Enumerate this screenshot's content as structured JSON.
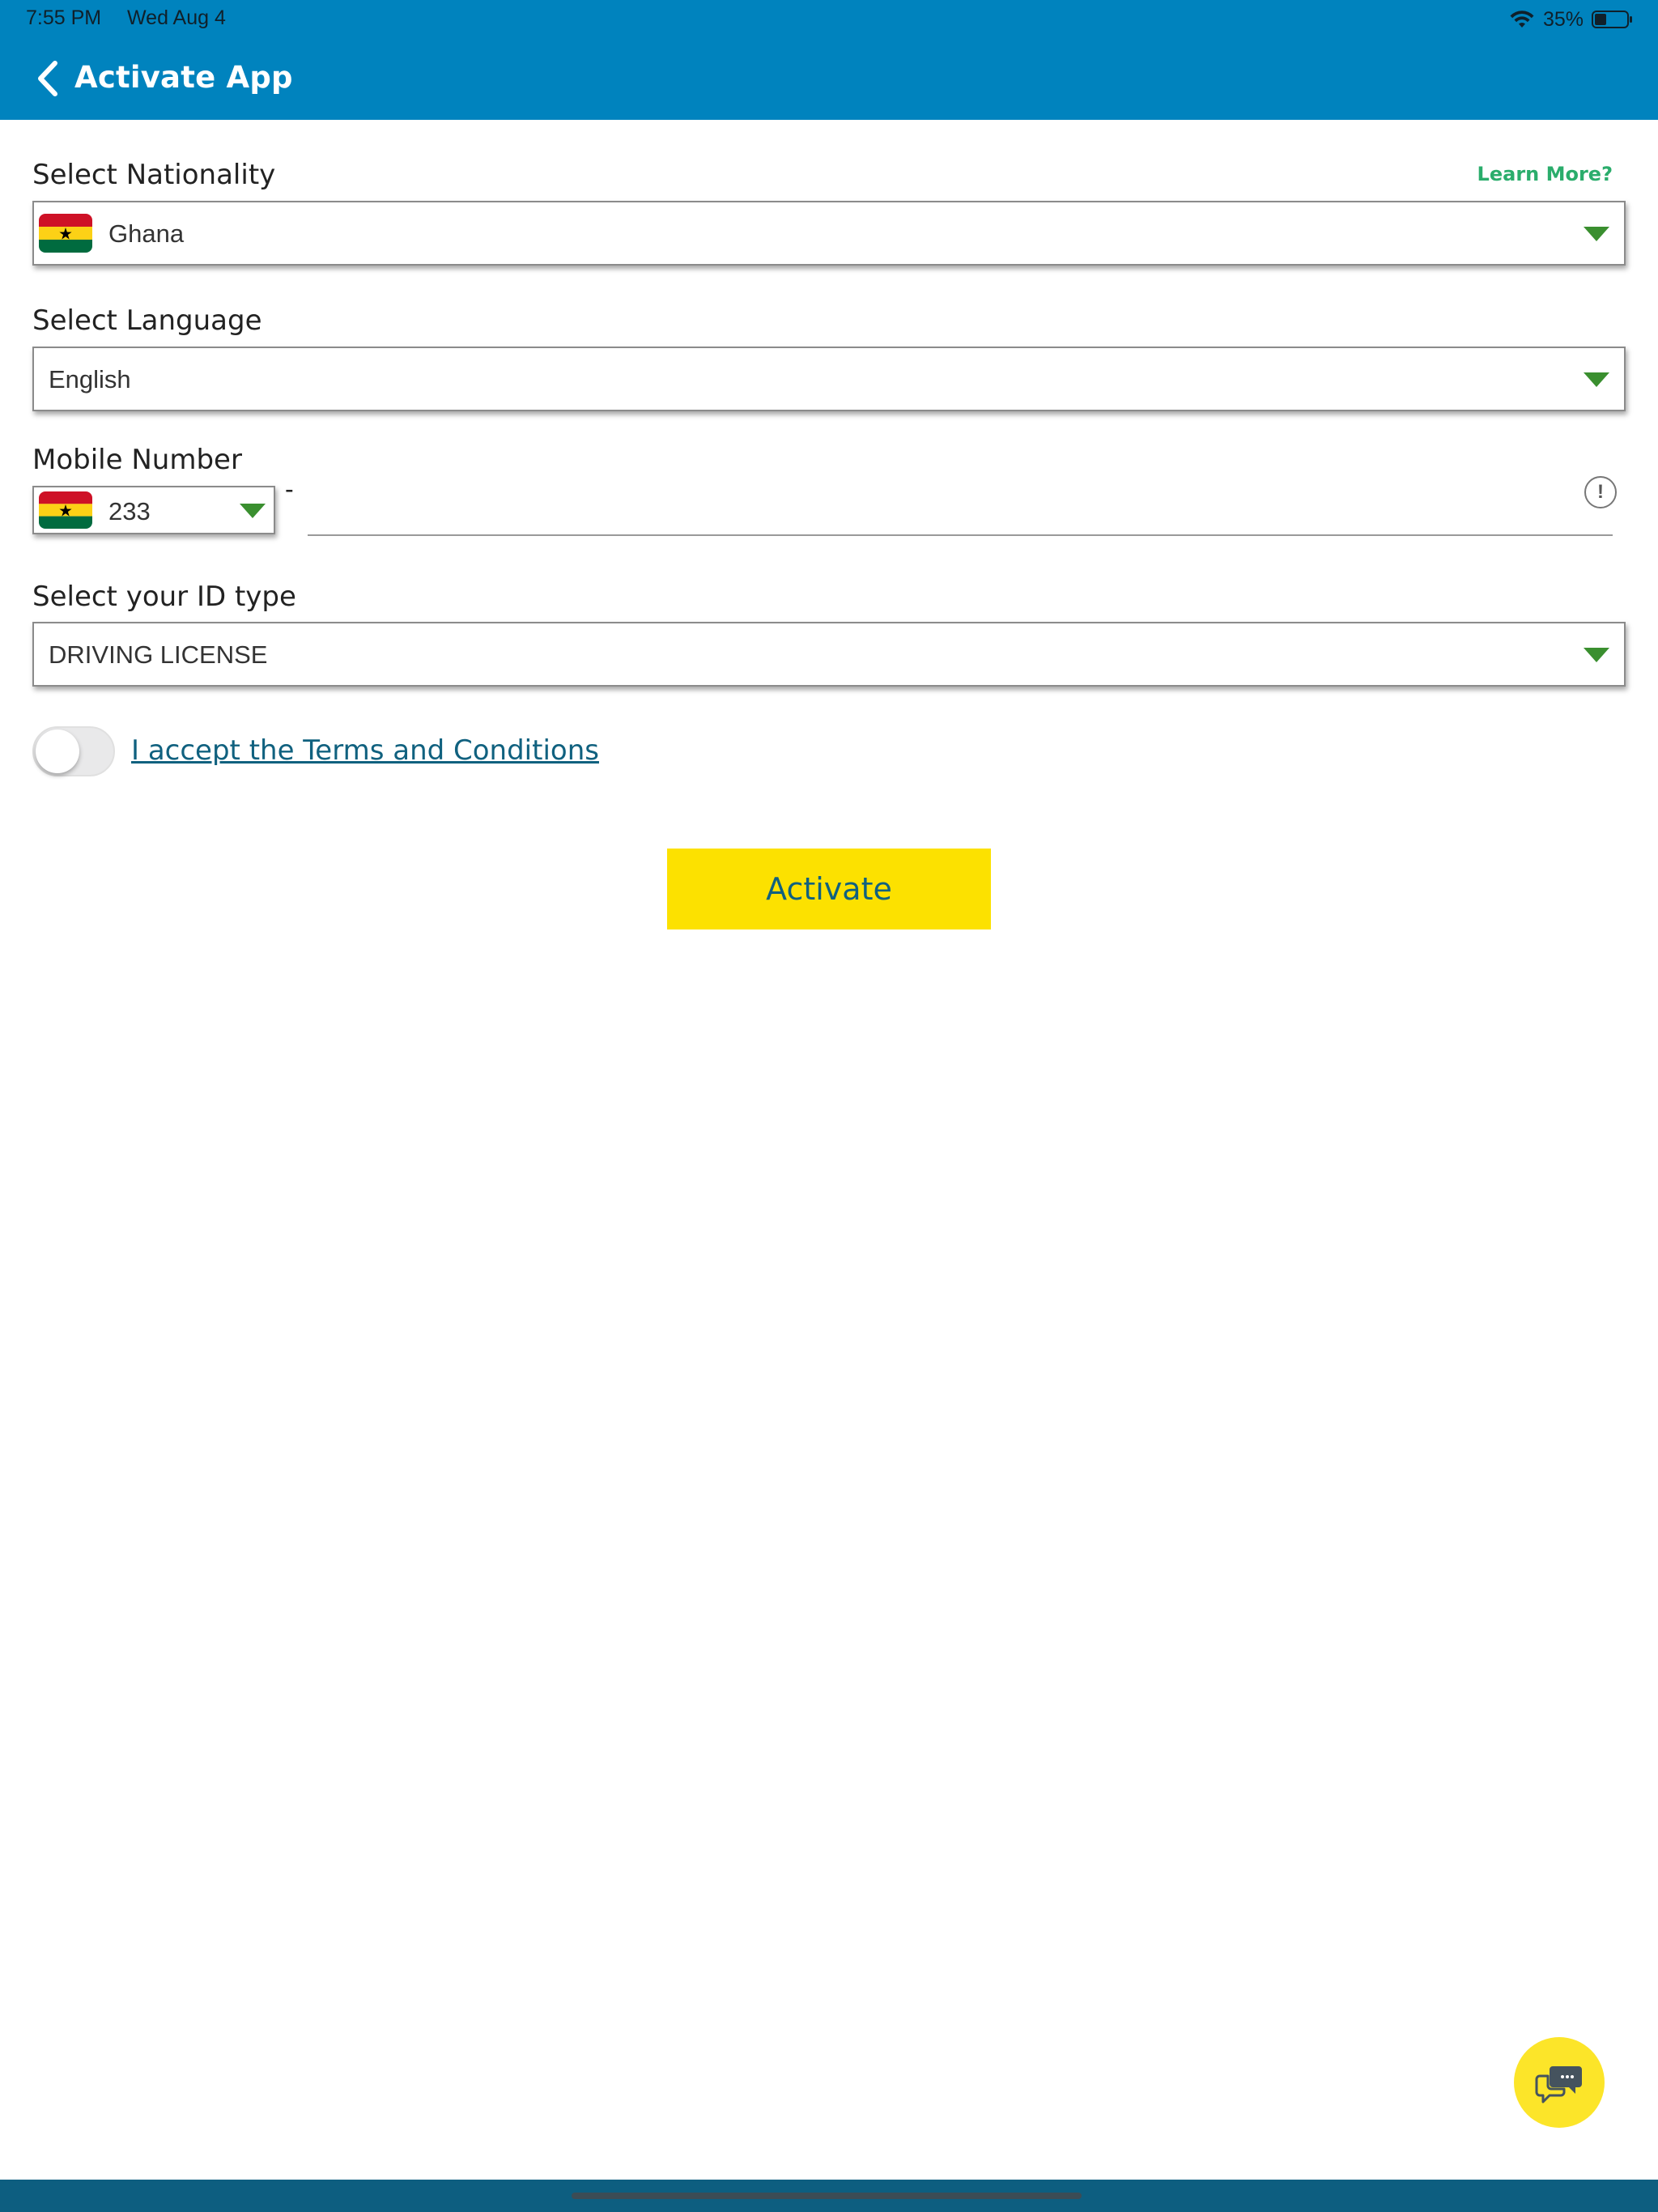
{
  "status_bar": {
    "time": "7:55 PM",
    "date": "Wed Aug 4",
    "battery": "35%"
  },
  "header": {
    "title": "Activate App"
  },
  "nationality": {
    "label": "Select Nationality",
    "learn_more": "Learn More?",
    "value": "Ghana"
  },
  "language": {
    "label": "Select Language",
    "value": "English"
  },
  "mobile": {
    "label": "Mobile Number",
    "country_code": "233",
    "separator": "-",
    "info": "!",
    "number": ""
  },
  "id_type": {
    "label": "Select your ID type",
    "value": "DRIVING LICENSE"
  },
  "terms": {
    "label": "I accept the Terms and Conditions",
    "accepted": false
  },
  "actions": {
    "activate_label": "Activate"
  },
  "colors": {
    "header": "#0083BE",
    "accent_green": "#3a8f2f",
    "button_yellow": "#fce100",
    "link_blue": "#10617f"
  },
  "icons": [
    "back-chevron-icon",
    "wifi-icon",
    "battery-icon",
    "ghana-flag-icon",
    "dropdown-caret-icon",
    "info-icon",
    "chat-icon"
  ]
}
